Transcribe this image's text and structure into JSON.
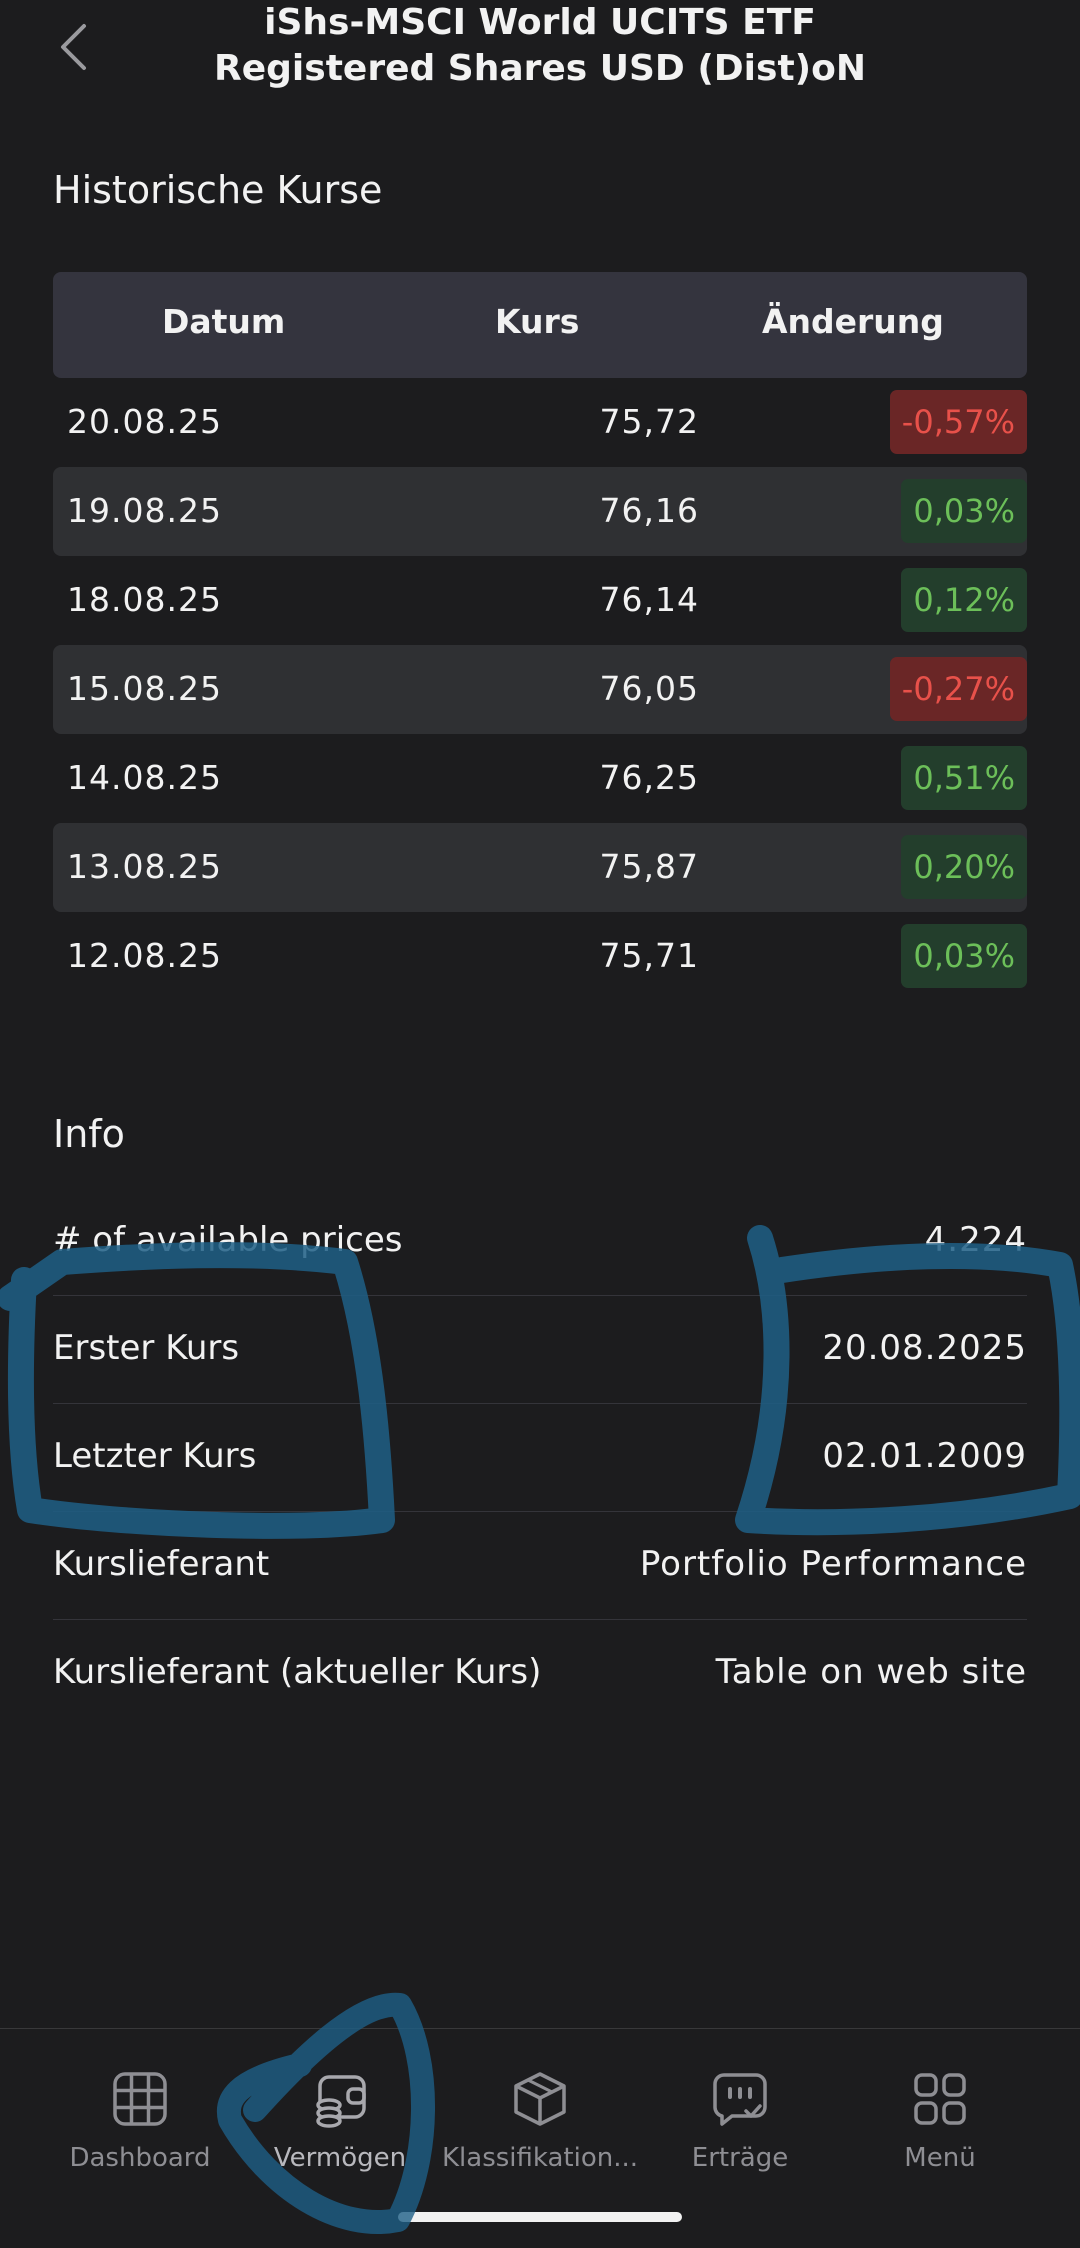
{
  "header": {
    "title": "iShs-MSCI World UCITS ETF Registered Shares USD (Dist)oN"
  },
  "history": {
    "section_title": "Historische Kurse",
    "columns": [
      "Datum",
      "Kurs",
      "Änderung"
    ],
    "rows": [
      {
        "date": "20.08.25",
        "price": "75,72",
        "change": "-0,57%",
        "trend": "neg"
      },
      {
        "date": "19.08.25",
        "price": "76,16",
        "change": "0,03%",
        "trend": "pos"
      },
      {
        "date": "18.08.25",
        "price": "76,14",
        "change": "0,12%",
        "trend": "pos"
      },
      {
        "date": "15.08.25",
        "price": "76,05",
        "change": "-0,27%",
        "trend": "neg"
      },
      {
        "date": "14.08.25",
        "price": "76,25",
        "change": "0,51%",
        "trend": "pos"
      },
      {
        "date": "13.08.25",
        "price": "75,87",
        "change": "0,20%",
        "trend": "pos"
      },
      {
        "date": "12.08.25",
        "price": "75,71",
        "change": "0,03%",
        "trend": "pos"
      }
    ]
  },
  "info": {
    "section_title": "Info",
    "rows": [
      {
        "label": "# of available prices",
        "value": "4.224"
      },
      {
        "label": "Erster Kurs",
        "value": "20.08.2025"
      },
      {
        "label": "Letzter Kurs",
        "value": "02.01.2009"
      },
      {
        "label": "Kurslieferant",
        "value": "Portfolio Performance"
      },
      {
        "label": "Kurslieferant (aktueller Kurs)",
        "value": "Table on web site"
      }
    ]
  },
  "nav": {
    "items": [
      {
        "label": "Dashboard",
        "icon": "grid-icon"
      },
      {
        "label": "Vermögen",
        "icon": "wallet-coins-icon"
      },
      {
        "label": "Klassifikation...",
        "icon": "cube-icon"
      },
      {
        "label": "Erträge",
        "icon": "chat-check-icon"
      },
      {
        "label": "Menü",
        "icon": "four-squares-icon"
      }
    ],
    "active": "Vermögen"
  },
  "colors": {
    "background": "#1c1c1e",
    "header_row": "#34343e",
    "negative_bg": "#6a2626",
    "negative_text": "#e8514a",
    "positive_bg": "#233e2c",
    "positive_text": "#6cbf59",
    "annotation": "#1e5f86"
  }
}
